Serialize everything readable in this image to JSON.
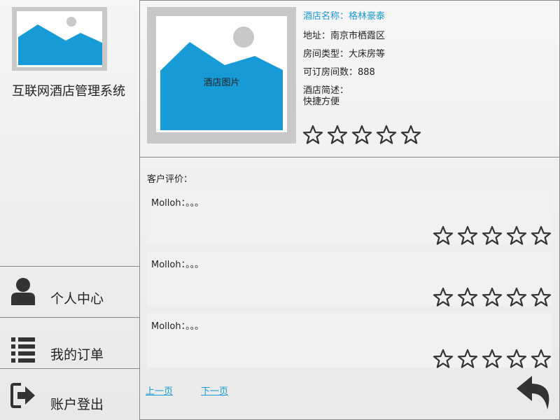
{
  "app": {
    "title": "互联网酒店管理系统"
  },
  "sidebar": {
    "items": [
      {
        "label": "个人中心",
        "icon": "user-icon"
      },
      {
        "label": "我的订单",
        "icon": "list-icon"
      },
      {
        "label": "账户登出",
        "icon": "logout-icon"
      }
    ]
  },
  "hotel": {
    "image_caption": "酒店图片",
    "name_line": "酒店名称：格林豪泰",
    "address_line": "地址：南京市栖霞区",
    "room_type_line": "房间类型：大床房等",
    "available_line": "可订房间数：888",
    "description_label": "酒店简述：",
    "description": "快捷方便",
    "rating_stars": 5
  },
  "reviews": {
    "title": "客户评价：",
    "items": [
      {
        "text": "Molloh：。。。",
        "stars": 5
      },
      {
        "text": "Molloh：。。。",
        "stars": 5
      },
      {
        "text": "Molloh：。。。",
        "stars": 5
      }
    ]
  },
  "pager": {
    "prev_label": "上一页",
    "next_label": "下一页"
  },
  "colors": {
    "accent": "#1a9ad6",
    "image_fill": "#179bd7",
    "icon_dark": "#333333"
  },
  "icons": {
    "back": "back-arrow-icon",
    "star": "star-outline-icon",
    "image": "image-placeholder-icon"
  }
}
